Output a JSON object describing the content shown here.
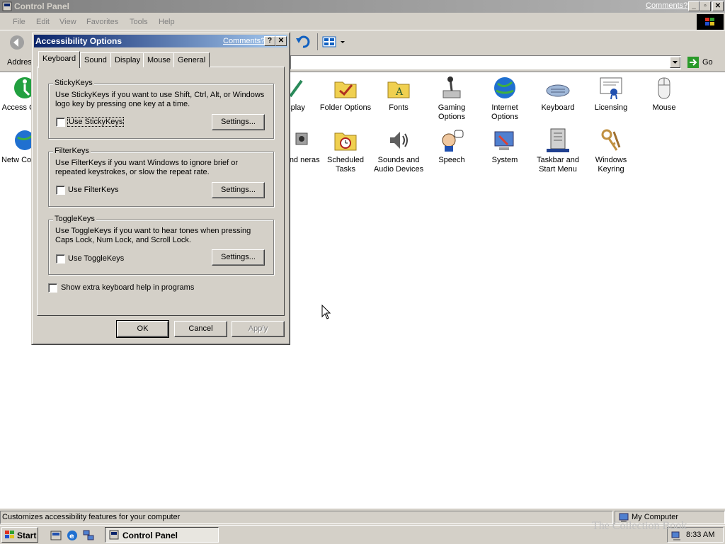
{
  "window": {
    "title": "Control Panel",
    "comments_link": "Comments?",
    "minimize": "_",
    "maximize": "▫",
    "close": "✕"
  },
  "menu": [
    "File",
    "Edit",
    "View",
    "Favorites",
    "Tools",
    "Help"
  ],
  "address": {
    "label": "Addres",
    "go_label": "Go"
  },
  "icons": [
    {
      "label": "Access Optio",
      "icon": "accessibility-icon"
    },
    {
      "label": "splay",
      "icon": "display-icon"
    },
    {
      "label": "Folder Options",
      "icon": "folder-options-icon"
    },
    {
      "label": "Fonts",
      "icon": "fonts-folder-icon"
    },
    {
      "label": "Gaming Options",
      "icon": "joystick-icon"
    },
    {
      "label": "Internet Options",
      "icon": "globe-icon"
    },
    {
      "label": "Keyboard",
      "icon": "keyboard-icon"
    },
    {
      "label": "Licensing",
      "icon": "certificate-icon"
    },
    {
      "label": "Mouse",
      "icon": "mouse-icon"
    },
    {
      "label": "Netw Connec",
      "icon": "network-globe-icon"
    },
    {
      "label": "ers and neras",
      "icon": "scanner-camera-icon"
    },
    {
      "label": "Scheduled Tasks",
      "icon": "scheduled-tasks-icon"
    },
    {
      "label": "Sounds and Audio Devices",
      "icon": "speaker-icon"
    },
    {
      "label": "Speech",
      "icon": "speech-icon"
    },
    {
      "label": "System",
      "icon": "system-icon"
    },
    {
      "label": "Taskbar and Start Menu",
      "icon": "taskbar-icon"
    },
    {
      "label": "Windows Keyring",
      "icon": "keyring-icon"
    }
  ],
  "dialog": {
    "title": "Accessibility Options",
    "comments": "Comments?",
    "help": "?",
    "close": "✕",
    "tabs": [
      "Keyboard",
      "Sound",
      "Display",
      "Mouse",
      "General"
    ],
    "active_tab": "Keyboard",
    "stickykeys": {
      "title": "StickyKeys",
      "desc": "Use StickyKeys if you want to use Shift, Ctrl, Alt, or Windows logo key by pressing one key at a time.",
      "checkbox": "Use StickyKeys",
      "checked": false,
      "settings": "Settings..."
    },
    "filterkeys": {
      "title": "FilterKeys",
      "desc": "Use FilterKeys if you want Windows to ignore brief or repeated keystrokes, or slow the repeat rate.",
      "checkbox": "Use FilterKeys",
      "checked": false,
      "settings": "Settings..."
    },
    "togglekeys": {
      "title": "ToggleKeys",
      "desc": "Use ToggleKeys if you want to hear tones when pressing Caps Lock, Num Lock, and Scroll Lock.",
      "checkbox": "Use ToggleKeys",
      "checked": false,
      "settings": "Settings..."
    },
    "extra_help": {
      "label": "Show extra keyboard help in programs",
      "checked": false
    },
    "ok": "OK",
    "cancel": "Cancel",
    "apply": "Apply"
  },
  "status": {
    "text": "Customizes accessibility features for your computer",
    "zone": "My Computer"
  },
  "taskbar": {
    "start": "Start",
    "task": "Control Panel",
    "clock": "8:33 AM",
    "watermark": "The Collection Book"
  }
}
